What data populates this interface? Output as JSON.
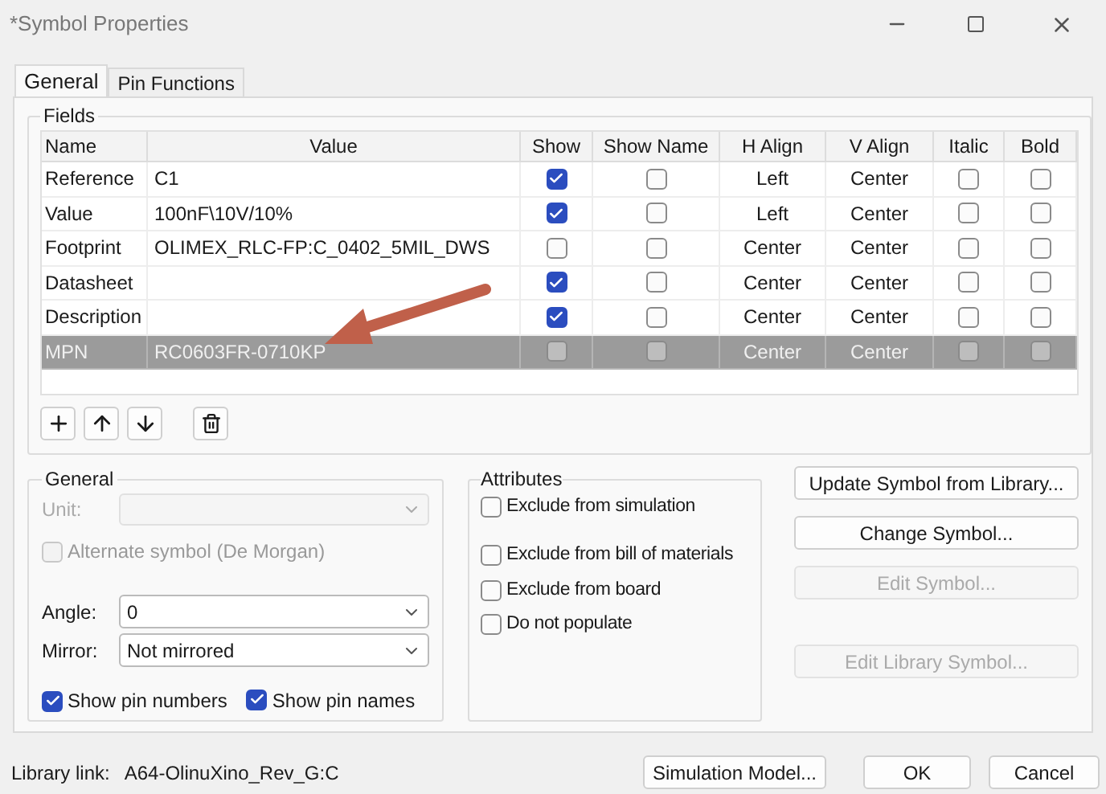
{
  "window": {
    "title": "*Symbol Properties"
  },
  "tabs": [
    {
      "label": "General",
      "selected": true
    },
    {
      "label": "Pin Functions",
      "selected": false
    }
  ],
  "fields": {
    "title": "Fields",
    "columns": [
      "Name",
      "Value",
      "Show",
      "Show Name",
      "H Align",
      "V Align",
      "Italic",
      "Bold"
    ],
    "rows": [
      {
        "name": "Reference",
        "value": "C1",
        "show": true,
        "show_name": false,
        "h_align": "Left",
        "v_align": "Center",
        "italic": false,
        "bold": false,
        "selected": false
      },
      {
        "name": "Value",
        "value": "100nF\\10V/10%",
        "show": true,
        "show_name": false,
        "h_align": "Left",
        "v_align": "Center",
        "italic": false,
        "bold": false,
        "selected": false
      },
      {
        "name": "Footprint",
        "value": "OLIMEX_RLC-FP:C_0402_5MIL_DWS",
        "show": false,
        "show_name": false,
        "h_align": "Center",
        "v_align": "Center",
        "italic": false,
        "bold": false,
        "selected": false
      },
      {
        "name": "Datasheet",
        "value": "",
        "show": true,
        "show_name": false,
        "h_align": "Center",
        "v_align": "Center",
        "italic": false,
        "bold": false,
        "selected": false
      },
      {
        "name": "Description",
        "value": "",
        "show": true,
        "show_name": false,
        "h_align": "Center",
        "v_align": "Center",
        "italic": false,
        "bold": false,
        "selected": false
      },
      {
        "name": "MPN",
        "value": "RC0603FR-0710KP",
        "show": false,
        "show_name": false,
        "h_align": "Center",
        "v_align": "Center",
        "italic": false,
        "bold": false,
        "selected": true
      }
    ]
  },
  "general": {
    "title": "General",
    "unit_label": "Unit:",
    "unit_disabled": true,
    "alternate": {
      "label": "Alternate symbol (De Morgan)",
      "checked": false,
      "disabled": true
    },
    "angle_label": "Angle:",
    "angle": "0",
    "mirror_label": "Mirror:",
    "mirror": "Not mirrored",
    "show_pin_numbers": {
      "label": "Show pin numbers",
      "checked": true
    },
    "show_pin_names": {
      "label": "Show pin names",
      "checked": true
    }
  },
  "attributes": {
    "title": "Attributes",
    "items": [
      {
        "label": "Exclude from simulation",
        "checked": false
      },
      {
        "label": "Exclude from bill of materials",
        "checked": false
      },
      {
        "label": "Exclude from board",
        "checked": false
      },
      {
        "label": "Do not populate",
        "checked": false
      }
    ]
  },
  "side_buttons": [
    {
      "label": "Update Symbol from Library...",
      "disabled": false
    },
    {
      "label": "Change Symbol...",
      "disabled": false
    },
    {
      "label": "Edit Symbol...",
      "disabled": true
    },
    {
      "label": "Edit Library Symbol...",
      "disabled": true
    }
  ],
  "footer": {
    "library_link_label": "Library link:",
    "library_link": "A64-OlinuXino_Rev_G:C",
    "buttons": [
      "Simulation Model...",
      "OK",
      "Cancel"
    ]
  }
}
